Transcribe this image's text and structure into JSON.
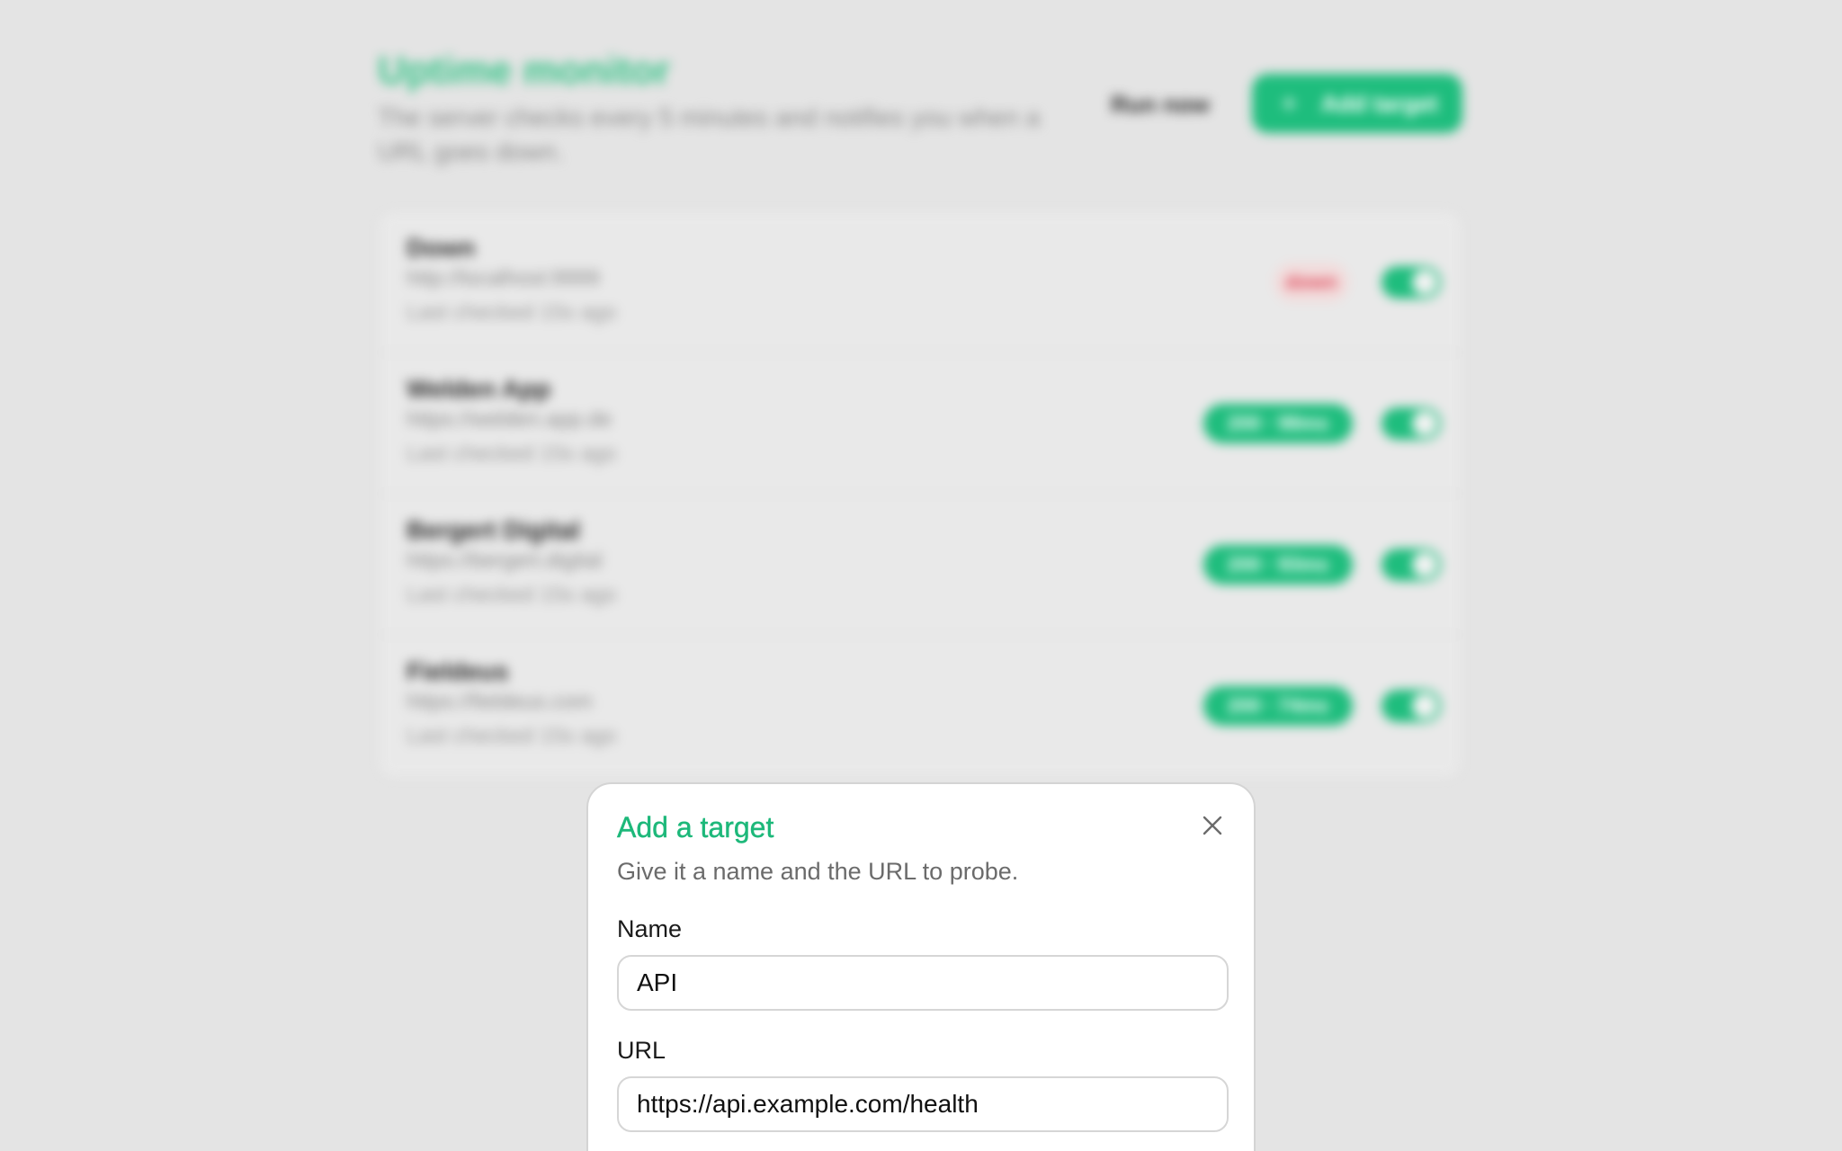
{
  "header": {
    "title": "Uptime monitor",
    "subtitle": "The server checks every 5 minutes and notifies you when a URL goes down.",
    "run_now_label": "Run now",
    "add_target_label": "Add target",
    "add_target_icon": "plus-icon"
  },
  "targets": [
    {
      "name": "Down",
      "url": "http://localhost:9999",
      "last_checked": "Last checked 15s ago",
      "status": "down",
      "status_label": "down",
      "enabled": true
    },
    {
      "name": "Welden App",
      "url": "https://welden.app.de",
      "last_checked": "Last checked 15s ago",
      "status": "up",
      "status_label": "200 · 98ms",
      "enabled": true
    },
    {
      "name": "Bergert Digital",
      "url": "https://bergert.digital",
      "last_checked": "Last checked 15s ago",
      "status": "up",
      "status_label": "200 · 93ms",
      "enabled": true
    },
    {
      "name": "Fieldeus",
      "url": "https://fieldeus.com",
      "last_checked": "Last checked 15s ago",
      "status": "up",
      "status_label": "200 · 74ms",
      "enabled": true
    }
  ],
  "modal": {
    "title": "Add a target",
    "description": "Give it a name and the URL to probe.",
    "close_icon": "close-icon",
    "name_label": "Name",
    "name_value": "API",
    "url_label": "URL",
    "url_value": "https://api.example.com/health"
  },
  "colors": {
    "accent": "#1ebd7d",
    "down": "#e0485a",
    "overlay_background": "#e4e4e4"
  }
}
